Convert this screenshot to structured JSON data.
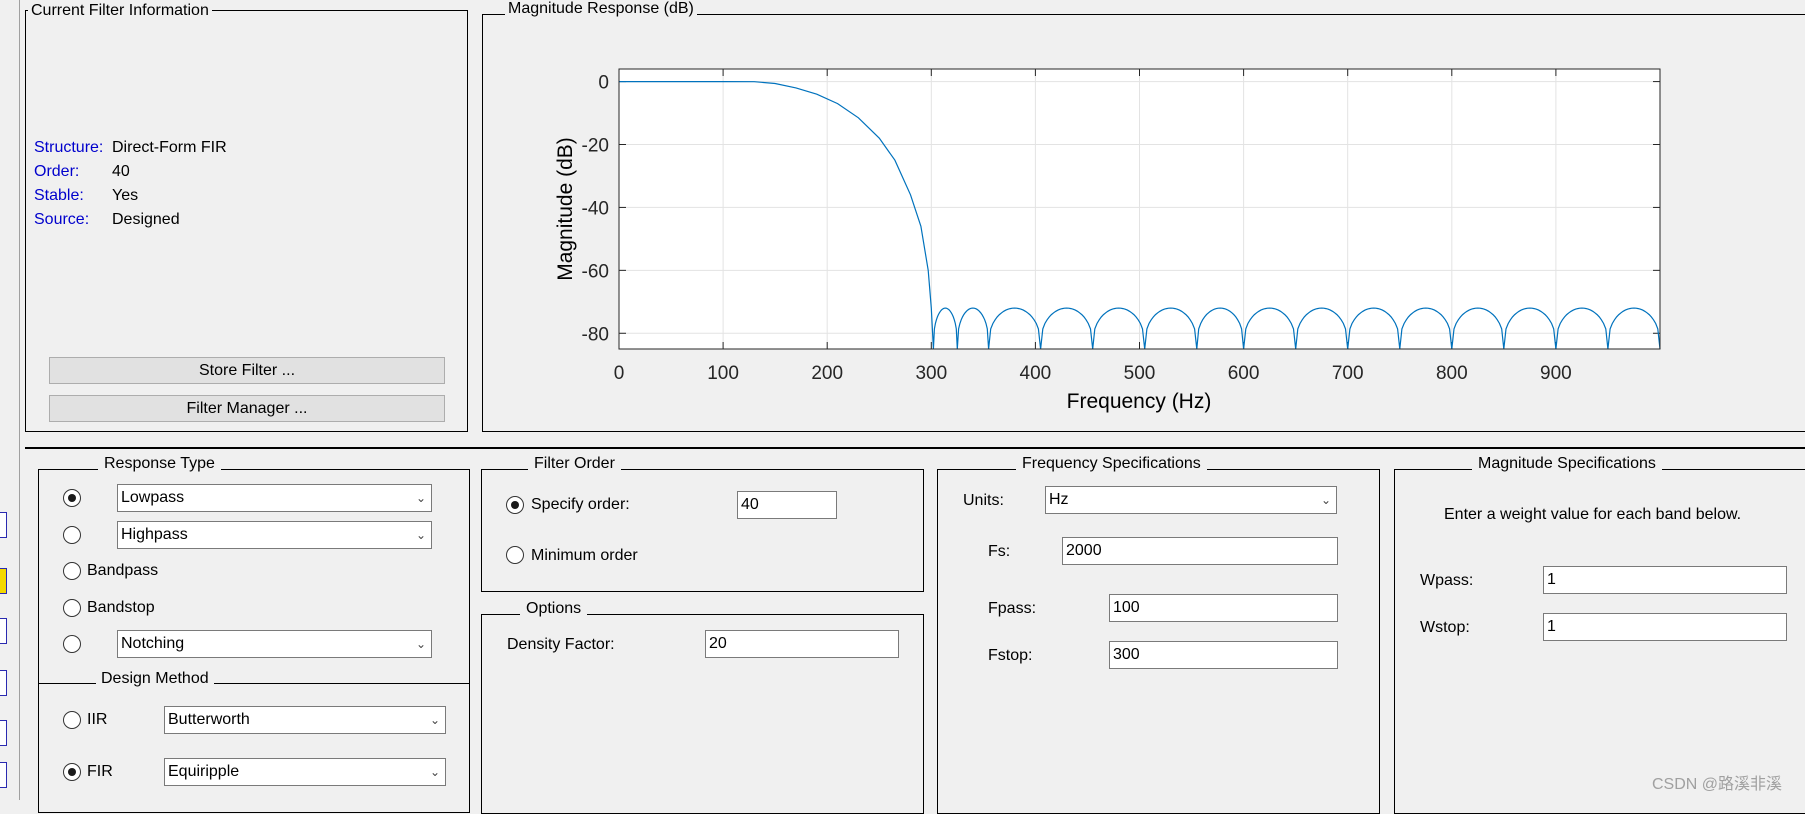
{
  "current_filter": {
    "title": "Current Filter Information",
    "rows": [
      {
        "label": "Structure:",
        "value": "Direct-Form FIR"
      },
      {
        "label": "Order:",
        "value": "40"
      },
      {
        "label": "Stable:",
        "value": "Yes"
      },
      {
        "label": "Source:",
        "value": "Designed"
      }
    ],
    "store_button": "Store Filter ...",
    "manager_button": "Filter Manager ..."
  },
  "magnitude_panel": {
    "title": "Magnitude Response (dB)"
  },
  "response_type": {
    "title": "Response Type",
    "options": [
      {
        "label": "Lowpass",
        "selected": true,
        "kind": "select"
      },
      {
        "label": "Highpass",
        "selected": false,
        "kind": "select"
      },
      {
        "label": "Bandpass",
        "selected": false,
        "kind": "radio-label"
      },
      {
        "label": "Bandstop",
        "selected": false,
        "kind": "radio-label"
      },
      {
        "label": "Notching",
        "selected": false,
        "kind": "select"
      }
    ]
  },
  "design_method": {
    "title": "Design Method",
    "iir_label": "IIR",
    "iir_value": "Butterworth",
    "fir_label": "FIR",
    "fir_value": "Equiripple",
    "selected": "FIR"
  },
  "filter_order": {
    "title": "Filter Order",
    "specify_label": "Specify order:",
    "specify_value": "40",
    "minimum_label": "Minimum order",
    "selected": "specify"
  },
  "options": {
    "title": "Options",
    "density_label": "Density Factor:",
    "density_value": "20"
  },
  "frequency_specs": {
    "title": "Frequency Specifications",
    "units_label": "Units:",
    "units_value": "Hz",
    "fs_label": "Fs:",
    "fs_value": "2000",
    "fpass_label": "Fpass:",
    "fpass_value": "100",
    "fstop_label": "Fstop:",
    "fstop_value": "300"
  },
  "magnitude_specs": {
    "title": "Magnitude Specifications",
    "description": "Enter a weight value for each band below.",
    "wpass_label": "Wpass:",
    "wpass_value": "1",
    "wstop_label": "Wstop:",
    "wstop_value": "1"
  },
  "watermark": "CSDN @路溪非溪",
  "chart_data": {
    "type": "line",
    "title": "",
    "xlabel": "Frequency (Hz)",
    "ylabel": "Magnitude (dB)",
    "xlim": [
      0,
      1000
    ],
    "ylim": [
      -85,
      4
    ],
    "xticks": [
      0,
      100,
      200,
      300,
      400,
      500,
      600,
      700,
      800,
      900
    ],
    "yticks": [
      0,
      -20,
      -40,
      -60,
      -80
    ],
    "grid": true,
    "line_color": "#0072bd",
    "series": [
      {
        "passband": [
          [
            0,
            0
          ],
          [
            100,
            0
          ],
          [
            130,
            -0.05
          ],
          [
            150,
            -0.6
          ],
          [
            170,
            -2
          ],
          [
            190,
            -4
          ],
          [
            210,
            -7
          ],
          [
            230,
            -11.5
          ],
          [
            250,
            -18
          ],
          [
            265,
            -25
          ],
          [
            280,
            -36
          ],
          [
            290,
            -46
          ],
          [
            297,
            -60
          ],
          [
            300,
            -72
          ],
          [
            302,
            -85
          ]
        ],
        "stopband_ripple_peak_db": -72,
        "stopband_nulls_hz": [
          302,
          325,
          355,
          405,
          455,
          505,
          555,
          600,
          650,
          700,
          750,
          800,
          850,
          900,
          950,
          1000
        ]
      }
    ]
  }
}
